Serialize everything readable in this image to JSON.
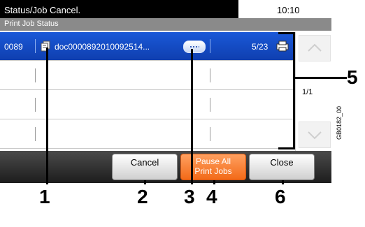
{
  "status_bar": {
    "title": "Status/Job Cancel.",
    "clock": "10:10"
  },
  "header": {
    "label": "Print Job Status"
  },
  "jobs": [
    {
      "id": "0089",
      "name": "doc0000892010092514...",
      "pages": "5/23",
      "selected": true
    },
    {
      "id": "",
      "name": "",
      "pages": "",
      "selected": false
    },
    {
      "id": "",
      "name": "",
      "pages": "",
      "selected": false
    },
    {
      "id": "",
      "name": "",
      "pages": "",
      "selected": false
    }
  ],
  "scroll": {
    "page_indicator": "1/1"
  },
  "buttons": {
    "cancel": "Cancel",
    "pause_line1": "Pause All",
    "pause_line2": "Print Jobs",
    "close": "Close"
  },
  "image_code": "GB0182_00",
  "callouts": {
    "c1": "1",
    "c2": "2",
    "c3": "3",
    "c4": "4",
    "c5": "5",
    "c6": "6"
  },
  "colors": {
    "selected_row": "#1a58d8",
    "pause_button": "#f26a18"
  }
}
